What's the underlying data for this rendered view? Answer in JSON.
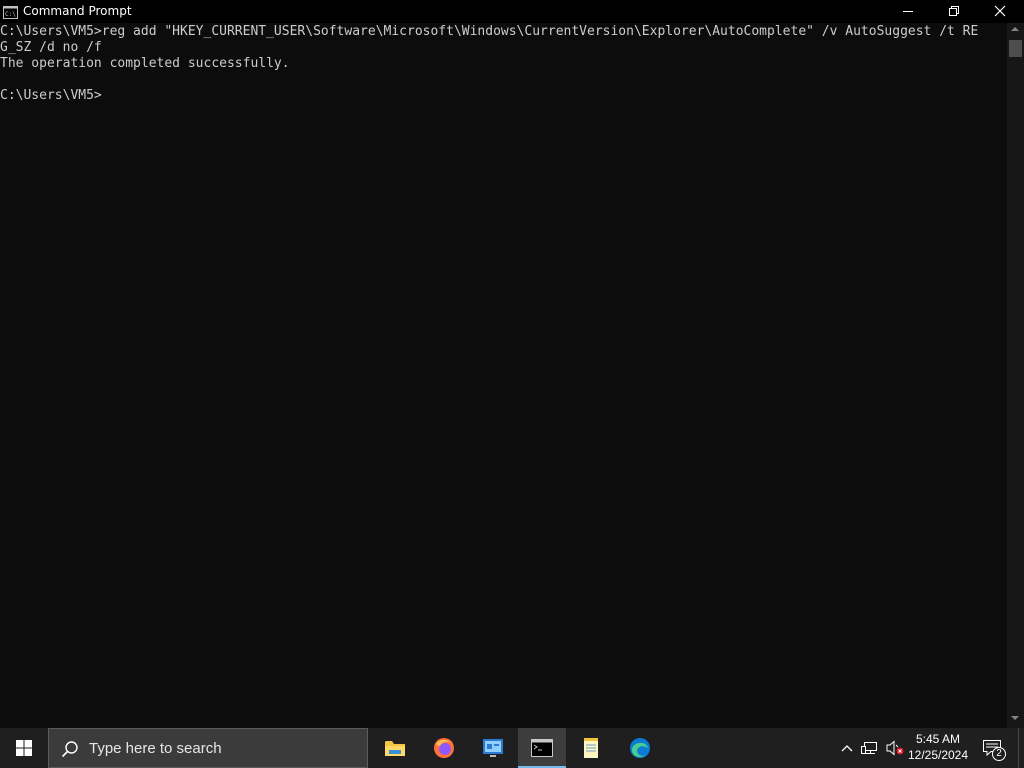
{
  "window": {
    "title": "Command Prompt",
    "icon": "command-prompt-icon"
  },
  "window_controls": {
    "minimize": "minimize-icon",
    "restore": "restore-icon",
    "close": "close-icon"
  },
  "console": {
    "lines": [
      "C:\\Users\\VM5>reg add \"HKEY_CURRENT_USER\\Software\\Microsoft\\Windows\\CurrentVersion\\Explorer\\AutoComplete\" /v AutoSuggest /t RE",
      "G_SZ /d no /f",
      "The operation completed successfully.",
      "",
      "C:\\Users\\VM5>"
    ],
    "text_color": "#cccccc",
    "background": "#0c0c0c"
  },
  "taskbar": {
    "search_placeholder": "Type here to search",
    "apps": [
      {
        "name": "File Explorer",
        "icon": "folder-icon",
        "active": false
      },
      {
        "name": "Firefox",
        "icon": "firefox-icon",
        "active": false
      },
      {
        "name": "Control Panel",
        "icon": "control-panel-icon",
        "active": false
      },
      {
        "name": "Command Prompt",
        "icon": "terminal-icon",
        "active": true
      },
      {
        "name": "Notepad",
        "icon": "notepad-icon",
        "active": false
      },
      {
        "name": "Microsoft Edge",
        "icon": "edge-icon",
        "active": false
      }
    ],
    "tray": {
      "time": "5:45 AM",
      "date": "12/25/2024",
      "notification_count": "2"
    },
    "accent": "#76b9ed"
  }
}
